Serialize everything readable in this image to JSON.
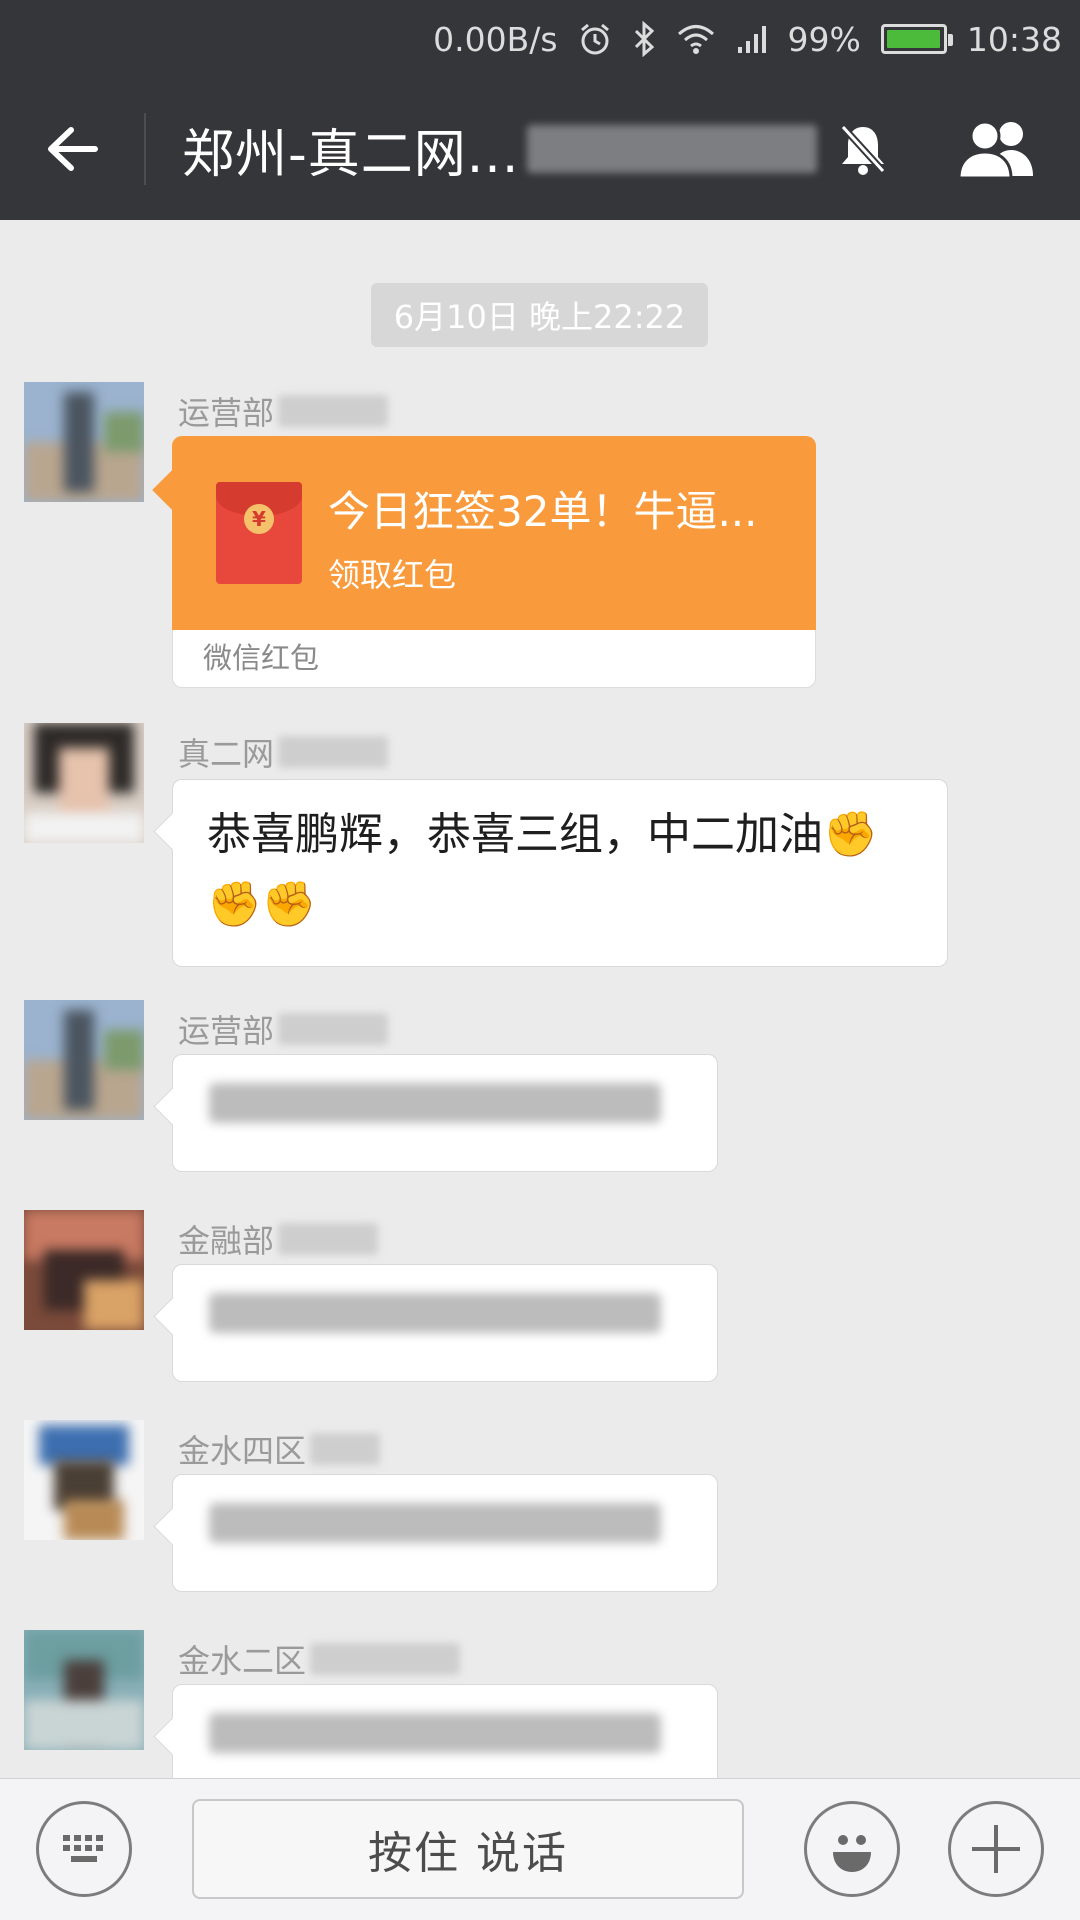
{
  "status_bar": {
    "net_speed": "0.00B/s",
    "battery": "99%",
    "battery_level": 0.99,
    "time": "10:38",
    "icons": [
      "alarm-icon",
      "bluetooth-icon",
      "wifi-icon",
      "signal-icon",
      "battery-icon"
    ]
  },
  "header": {
    "title": "郑州-真二网...",
    "icons": [
      "back-arrow-icon",
      "mute-bell-icon",
      "group-members-icon"
    ]
  },
  "chat": {
    "timestamp": "6月10日 晚上22:22",
    "messages": [
      {
        "sender": "运营部",
        "type": "red_packet",
        "packet_title": "今日狂签32单！牛逼...",
        "packet_action": "领取红包",
        "packet_footer": "微信红包",
        "packet_coin": "¥"
      },
      {
        "sender": "真二网",
        "type": "text",
        "text": "恭喜鹏辉，恭喜三组，中二加油",
        "emoji": "✊",
        "emoji_count": 3
      },
      {
        "sender": "运营部",
        "type": "text_blurred"
      },
      {
        "sender": "金融部",
        "type": "text_blurred"
      },
      {
        "sender": "金水四区",
        "type": "text_blurred"
      },
      {
        "sender": "金水二区",
        "type": "text_blurred"
      }
    ]
  },
  "input_bar": {
    "hold_to_talk": "按住 说话",
    "icons": [
      "keyboard-icon",
      "emoji-icon",
      "plus-icon"
    ]
  },
  "colors": {
    "header_bg": "#35363a",
    "chat_bg": "#ebebeb",
    "red_packet": "#f99b3c",
    "envelope": "#e8473b",
    "battery_fill": "#4cbb3c"
  }
}
